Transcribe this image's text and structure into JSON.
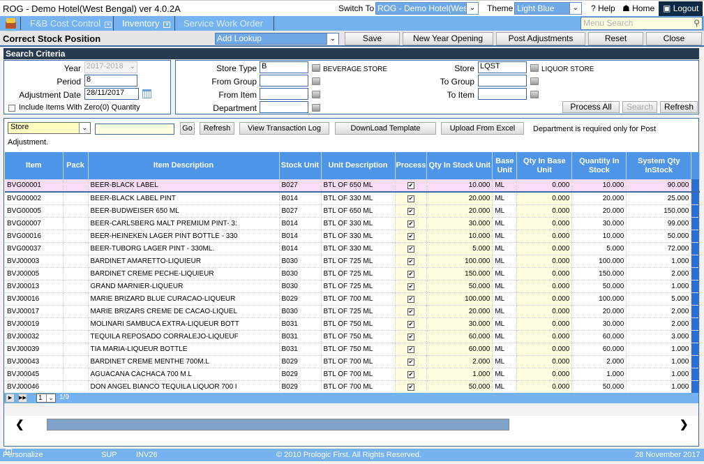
{
  "titlebar": {
    "app_title": "ROG - Demo Hotel(West Bengal) ver 4.0.2A",
    "switch_to_label": "Switch To",
    "switch_to_value": "ROG - Demo Hotel(West",
    "theme_label": "Theme",
    "theme_value": "Light Blue",
    "help_label": "? Help",
    "home_label": "Home",
    "logout_label": "Logout"
  },
  "menubar": {
    "items": [
      {
        "label": "F&B Cost Control"
      },
      {
        "label": "Inventory"
      },
      {
        "label": "Service Work Order"
      }
    ],
    "search_placeholder": "Menu Search"
  },
  "page": {
    "title": "Correct Stock Position",
    "lookup_value": "Add Lookup",
    "buttons": {
      "save": "Save",
      "new_year_opening": "New Year Opening",
      "post_adjustments": "Post Adjustments",
      "reset": "Reset",
      "close": "Close"
    }
  },
  "search_criteria": {
    "header": "Search Criteria",
    "year_label": "Year",
    "year_value": "2017-2018",
    "period_label": "Period",
    "period_value": "8",
    "adj_date_label": "Adjustment Date",
    "adj_date_value": "28/11/2017",
    "include_zero_label": "Include Items With Zero(0) Quantity",
    "store_type_label": "Store Type",
    "store_type_value": "B",
    "store_type_desc": "BEVERAGE STORE",
    "from_group_label": "From Group",
    "from_group_value": "",
    "from_item_label": "From Item",
    "from_item_value": "",
    "department_label": "Department",
    "department_value": "",
    "store_label": "Store",
    "store_value": "LQST",
    "store_desc": "LIQUOR STORE",
    "to_group_label": "To Group",
    "to_group_value": "",
    "to_item_label": "To Item",
    "to_item_value": "",
    "process_all": "Process All",
    "search": "Search",
    "refresh": "Refresh"
  },
  "grid_toolbar": {
    "filter_select": "Store",
    "filter_value": "",
    "go": "Go",
    "refresh": "Refresh",
    "view_log": "View Transaction Log",
    "download": "DownLoad Template",
    "upload": "Upload From Excel",
    "note_line1": "Department is required only for Post",
    "note_line2": "Adjustment."
  },
  "grid": {
    "columns": [
      "Item",
      "Pack",
      "Item Description",
      "Stock Unit",
      "Unit Description",
      "Process",
      "Qty In Stock Unit",
      "Base Unit",
      "Qty In Base Unit",
      "Quantity In Stock",
      "System Qty InStock"
    ],
    "rows": [
      {
        "item": "BVG00001",
        "pack": "",
        "desc": "BEER-BLACK LABEL",
        "su": "B027",
        "ud": "BTL OF 650 ML",
        "process": true,
        "qsu": "10.000",
        "bu": "ML",
        "qbu": "0.000",
        "qis": "10.000",
        "sys": "90.000",
        "selected": true
      },
      {
        "item": "BVG00002",
        "pack": "",
        "desc": "BEER-BLACK LABEL PINT",
        "su": "B014",
        "ud": "BTL OF 330 ML",
        "process": true,
        "qsu": "20.000",
        "bu": "ML",
        "qbu": "0.000",
        "qis": "20.000",
        "sys": "25.000"
      },
      {
        "item": "BVG00005",
        "pack": "",
        "desc": "BEER-BUDWEISER  650 ML",
        "su": "B027",
        "ud": "BTL OF 650 ML",
        "process": true,
        "qsu": "20.000",
        "bu": "ML",
        "qbu": "0.000",
        "qis": "20.000",
        "sys": "150.000"
      },
      {
        "item": "BVG00007",
        "pack": "",
        "desc": "BEER-CARLSBERG MALT PREMIUM PINT- 3:",
        "su": "B014",
        "ud": "BTL OF 330 ML",
        "process": true,
        "qsu": "30.000",
        "bu": "ML",
        "qbu": "0.000",
        "qis": "30.000",
        "sys": "99.000"
      },
      {
        "item": "BVG00016",
        "pack": "",
        "desc": "BEER-HEINEKEN LAGER PINT BOTTLE - 330",
        "su": "B014",
        "ud": "BTL OF 330 ML",
        "process": true,
        "qsu": "10.000",
        "bu": "ML",
        "qbu": "0.000",
        "qis": "10.000",
        "sys": "50.000"
      },
      {
        "item": "BVG00037",
        "pack": "",
        "desc": "BEER-TUBORG LAGER PINT - 330ML.",
        "su": "B014",
        "ud": "BTL OF 330 ML",
        "process": true,
        "qsu": "5.000",
        "bu": "ML",
        "qbu": "0.000",
        "qis": "5.000",
        "sys": "72.000"
      },
      {
        "item": "BVJ00003",
        "pack": "",
        "desc": "BARDINET AMARETTO-LIQUIEUR",
        "su": "B030",
        "ud": "BTL OF 725 ML",
        "process": true,
        "qsu": "100.000",
        "bu": "ML",
        "qbu": "0.000",
        "qis": "100.000",
        "sys": "1.000"
      },
      {
        "item": "BVJ00005",
        "pack": "",
        "desc": "BARDINET CREME PECHE-LIQUIEUR",
        "su": "B030",
        "ud": "BTL OF 725 ML",
        "process": true,
        "qsu": "150.000",
        "bu": "ML",
        "qbu": "0.000",
        "qis": "150.000",
        "sys": "2.000"
      },
      {
        "item": "BVJ00013",
        "pack": "",
        "desc": "GRAND MARNIER-LIQUEUR",
        "su": "B030",
        "ud": "BTL OF 725 ML",
        "process": true,
        "qsu": "50.000",
        "bu": "ML",
        "qbu": "0.000",
        "qis": "50.000",
        "sys": "1.000"
      },
      {
        "item": "BVJ00016",
        "pack": "",
        "desc": "MARIE BRIZARD BLUE CURACAO-LIQUEUR",
        "su": "B029",
        "ud": "BTL OF 700 ML",
        "process": true,
        "qsu": "100.000",
        "bu": "ML",
        "qbu": "0.000",
        "qis": "100.000",
        "sys": "5.000"
      },
      {
        "item": "BVJ00017",
        "pack": "",
        "desc": "MARIE BRIZARS CREME DE CACAO-LIQUEL",
        "su": "B030",
        "ud": "BTL OF 725 ML",
        "process": true,
        "qsu": "20.000",
        "bu": "ML",
        "qbu": "0.000",
        "qis": "20.000",
        "sys": "2.000"
      },
      {
        "item": "BVJ00019",
        "pack": "",
        "desc": "MOLINARI SAMBUCA EXTRA-LIQUEUR BOTT",
        "su": "B031",
        "ud": "BTL OF 750 ML",
        "process": true,
        "qsu": "30.000",
        "bu": "ML",
        "qbu": "0.000",
        "qis": "30.000",
        "sys": "2.000"
      },
      {
        "item": "BVJ00032",
        "pack": "",
        "desc": "TEQUILA REPOSADO CORRALEJO-LIQUEUF",
        "su": "B031",
        "ud": "BTL OF 750 ML",
        "process": true,
        "qsu": "60.000",
        "bu": "ML",
        "qbu": "0.000",
        "qis": "60.000",
        "sys": "3.000"
      },
      {
        "item": "BVJ00039",
        "pack": "",
        "desc": "TIA MARIA-LIQUEUR BOTTLE",
        "su": "B031",
        "ud": "BTL OF 750 ML",
        "process": true,
        "qsu": "60.000",
        "bu": "ML",
        "qbu": "0.000",
        "qis": "60.000",
        "sys": "1.000"
      },
      {
        "item": "BVJ00043",
        "pack": "",
        "desc": "BARDINET CREME MENTHE 700M.L",
        "su": "B029",
        "ud": "BTL OF 700 ML",
        "process": true,
        "qsu": "2.000",
        "bu": "ML",
        "qbu": "0.000",
        "qis": "2.000",
        "sys": "1.000"
      },
      {
        "item": "BVJ00045",
        "pack": "",
        "desc": "AGUACANA CACHACA 700 M.L",
        "su": "B029",
        "ud": "BTL OF 700 ML",
        "process": true,
        "qsu": "1.000",
        "bu": "ML",
        "qbu": "0.000",
        "qis": "1.000",
        "sys": "1.000"
      },
      {
        "item": "BVJ00046",
        "pack": "",
        "desc": "DON ANGEL BIANCO TEQUILA LIQUOR 700 I",
        "su": "B029",
        "ud": "BTL OF 700 ML",
        "process": true,
        "qsu": "50.000",
        "bu": "ML",
        "qbu": "0.000",
        "qis": "50.000",
        "sys": "1.000"
      }
    ]
  },
  "pager": {
    "page_select": "1",
    "page_info": "1/9"
  },
  "statusbar": {
    "personalize": "Personalize",
    "user": "SUP",
    "screen_code": "INV26",
    "copyright": "© 2010 Prologic First. All Rights Reserved.",
    "date": "28 November 2017"
  }
}
